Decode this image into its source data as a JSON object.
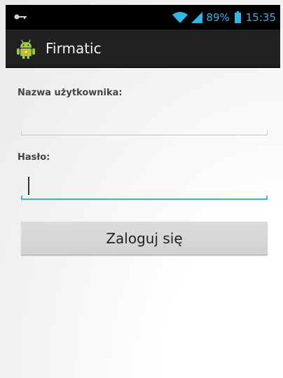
{
  "status_bar": {
    "battery": "89%",
    "time": "15:35",
    "icons": [
      "key-icon",
      "wifi-icon",
      "signal-icon",
      "battery-icon"
    ],
    "accent_color": "#33b5e5"
  },
  "action_bar": {
    "title": "Firmatic",
    "icon": "android-app-icon"
  },
  "form": {
    "username_label": "Nazwa użytkownika:",
    "username_value": "",
    "password_label": "Hasło:",
    "password_value": "",
    "login_button": "Zaloguj się"
  }
}
